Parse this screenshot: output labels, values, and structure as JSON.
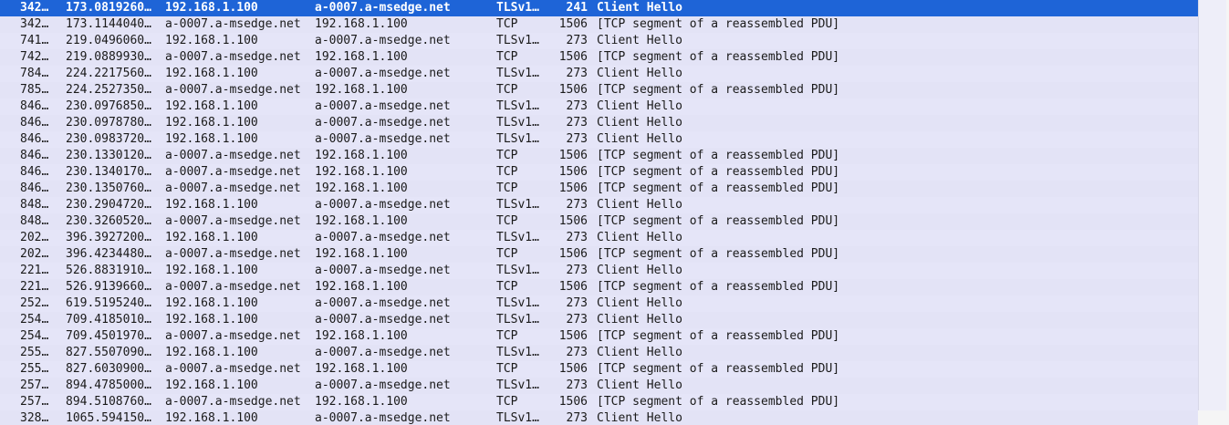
{
  "packets": [
    {
      "no": "342…",
      "time": "173.0819260…",
      "source": "192.168.1.100",
      "destination": "a-0007.a-msedge.net",
      "protocol": "TLSv1…",
      "length": "241",
      "info": "Client Hello",
      "selected": true
    },
    {
      "no": "342…",
      "time": "173.1144040…",
      "source": "a-0007.a-msedge.net",
      "destination": "192.168.1.100",
      "protocol": "TCP",
      "length": "1506",
      "info": "[TCP segment of a reassembled PDU]"
    },
    {
      "no": "741…",
      "time": "219.0496060…",
      "source": "192.168.1.100",
      "destination": "a-0007.a-msedge.net",
      "protocol": "TLSv1…",
      "length": "273",
      "info": "Client Hello"
    },
    {
      "no": "742…",
      "time": "219.0889930…",
      "source": "a-0007.a-msedge.net",
      "destination": "192.168.1.100",
      "protocol": "TCP",
      "length": "1506",
      "info": "[TCP segment of a reassembled PDU]"
    },
    {
      "no": "784…",
      "time": "224.2217560…",
      "source": "192.168.1.100",
      "destination": "a-0007.a-msedge.net",
      "protocol": "TLSv1…",
      "length": "273",
      "info": "Client Hello"
    },
    {
      "no": "785…",
      "time": "224.2527350…",
      "source": "a-0007.a-msedge.net",
      "destination": "192.168.1.100",
      "protocol": "TCP",
      "length": "1506",
      "info": "[TCP segment of a reassembled PDU]"
    },
    {
      "no": "846…",
      "time": "230.0976850…",
      "source": "192.168.1.100",
      "destination": "a-0007.a-msedge.net",
      "protocol": "TLSv1…",
      "length": "273",
      "info": "Client Hello"
    },
    {
      "no": "846…",
      "time": "230.0978780…",
      "source": "192.168.1.100",
      "destination": "a-0007.a-msedge.net",
      "protocol": "TLSv1…",
      "length": "273",
      "info": "Client Hello"
    },
    {
      "no": "846…",
      "time": "230.0983720…",
      "source": "192.168.1.100",
      "destination": "a-0007.a-msedge.net",
      "protocol": "TLSv1…",
      "length": "273",
      "info": "Client Hello"
    },
    {
      "no": "846…",
      "time": "230.1330120…",
      "source": "a-0007.a-msedge.net",
      "destination": "192.168.1.100",
      "protocol": "TCP",
      "length": "1506",
      "info": "[TCP segment of a reassembled PDU]"
    },
    {
      "no": "846…",
      "time": "230.1340170…",
      "source": "a-0007.a-msedge.net",
      "destination": "192.168.1.100",
      "protocol": "TCP",
      "length": "1506",
      "info": "[TCP segment of a reassembled PDU]"
    },
    {
      "no": "846…",
      "time": "230.1350760…",
      "source": "a-0007.a-msedge.net",
      "destination": "192.168.1.100",
      "protocol": "TCP",
      "length": "1506",
      "info": "[TCP segment of a reassembled PDU]"
    },
    {
      "no": "848…",
      "time": "230.2904720…",
      "source": "192.168.1.100",
      "destination": "a-0007.a-msedge.net",
      "protocol": "TLSv1…",
      "length": "273",
      "info": "Client Hello"
    },
    {
      "no": "848…",
      "time": "230.3260520…",
      "source": "a-0007.a-msedge.net",
      "destination": "192.168.1.100",
      "protocol": "TCP",
      "length": "1506",
      "info": "[TCP segment of a reassembled PDU]"
    },
    {
      "no": "202…",
      "time": "396.3927200…",
      "source": "192.168.1.100",
      "destination": "a-0007.a-msedge.net",
      "protocol": "TLSv1…",
      "length": "273",
      "info": "Client Hello"
    },
    {
      "no": "202…",
      "time": "396.4234480…",
      "source": "a-0007.a-msedge.net",
      "destination": "192.168.1.100",
      "protocol": "TCP",
      "length": "1506",
      "info": "[TCP segment of a reassembled PDU]"
    },
    {
      "no": "221…",
      "time": "526.8831910…",
      "source": "192.168.1.100",
      "destination": "a-0007.a-msedge.net",
      "protocol": "TLSv1…",
      "length": "273",
      "info": "Client Hello"
    },
    {
      "no": "221…",
      "time": "526.9139660…",
      "source": "a-0007.a-msedge.net",
      "destination": "192.168.1.100",
      "protocol": "TCP",
      "length": "1506",
      "info": "[TCP segment of a reassembled PDU]"
    },
    {
      "no": "252…",
      "time": "619.5195240…",
      "source": "192.168.1.100",
      "destination": "a-0007.a-msedge.net",
      "protocol": "TLSv1…",
      "length": "273",
      "info": "Client Hello"
    },
    {
      "no": "254…",
      "time": "709.4185010…",
      "source": "192.168.1.100",
      "destination": "a-0007.a-msedge.net",
      "protocol": "TLSv1…",
      "length": "273",
      "info": "Client Hello"
    },
    {
      "no": "254…",
      "time": "709.4501970…",
      "source": "a-0007.a-msedge.net",
      "destination": "192.168.1.100",
      "protocol": "TCP",
      "length": "1506",
      "info": "[TCP segment of a reassembled PDU]"
    },
    {
      "no": "255…",
      "time": "827.5507090…",
      "source": "192.168.1.100",
      "destination": "a-0007.a-msedge.net",
      "protocol": "TLSv1…",
      "length": "273",
      "info": "Client Hello"
    },
    {
      "no": "255…",
      "time": "827.6030900…",
      "source": "a-0007.a-msedge.net",
      "destination": "192.168.1.100",
      "protocol": "TCP",
      "length": "1506",
      "info": "[TCP segment of a reassembled PDU]"
    },
    {
      "no": "257…",
      "time": "894.4785000…",
      "source": "192.168.1.100",
      "destination": "a-0007.a-msedge.net",
      "protocol": "TLSv1…",
      "length": "273",
      "info": "Client Hello"
    },
    {
      "no": "257…",
      "time": "894.5108760…",
      "source": "a-0007.a-msedge.net",
      "destination": "192.168.1.100",
      "protocol": "TCP",
      "length": "1506",
      "info": "[TCP segment of a reassembled PDU]"
    },
    {
      "no": "328…",
      "time": "1065.594150…",
      "source": "192.168.1.100",
      "destination": "a-0007.a-msedge.net",
      "protocol": "TLSv1…",
      "length": "273",
      "info": "Client Hello"
    }
  ],
  "colors": {
    "row_background": "#e5e5f8",
    "selected_background": "#1e64d7",
    "selected_text": "#ffffff",
    "text": "#1a1a1a"
  }
}
